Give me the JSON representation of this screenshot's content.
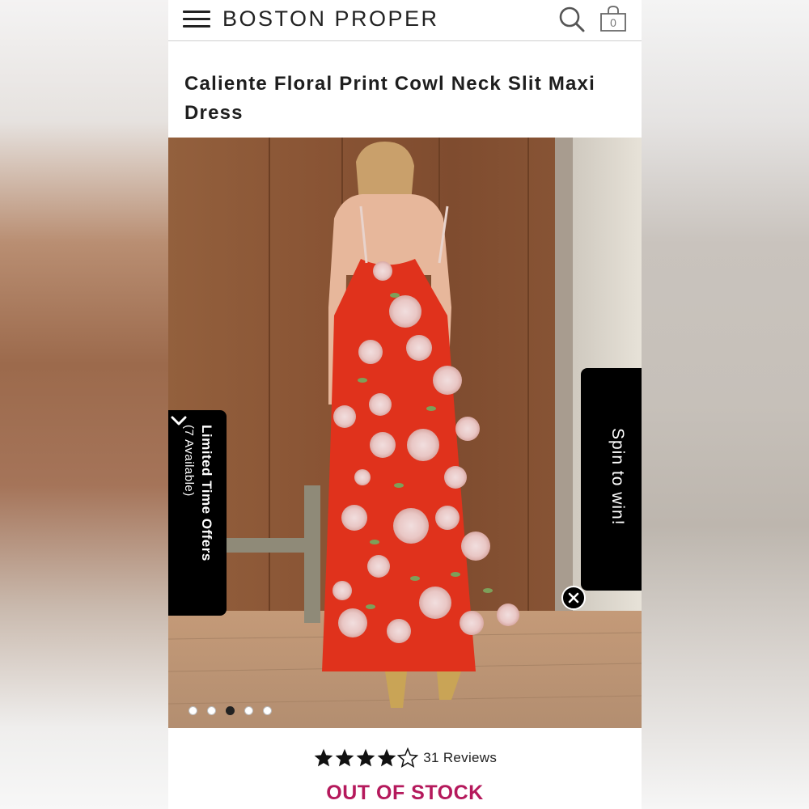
{
  "header": {
    "brand": "BOSTON PROPER",
    "bag_count": "0",
    "icons": [
      "hamburger-menu-icon",
      "search-icon",
      "shopping-bag-icon"
    ]
  },
  "product": {
    "title": "Caliente Floral Print Cowl Neck Slit Maxi Dress",
    "rating": 4,
    "rating_max": 5,
    "reviews_label": "31 Reviews",
    "stock_status": "OUT OF STOCK"
  },
  "gallery": {
    "image_count": 5,
    "active_index": 2
  },
  "offers_tab": {
    "title": "Limited Time Offers",
    "subtitle": "(7 Available)"
  },
  "spin_tab": {
    "label": "Spin to win!"
  },
  "colors": {
    "stock_status": "#b5195c",
    "tab_background": "#000000",
    "dress": "#e0321c"
  }
}
